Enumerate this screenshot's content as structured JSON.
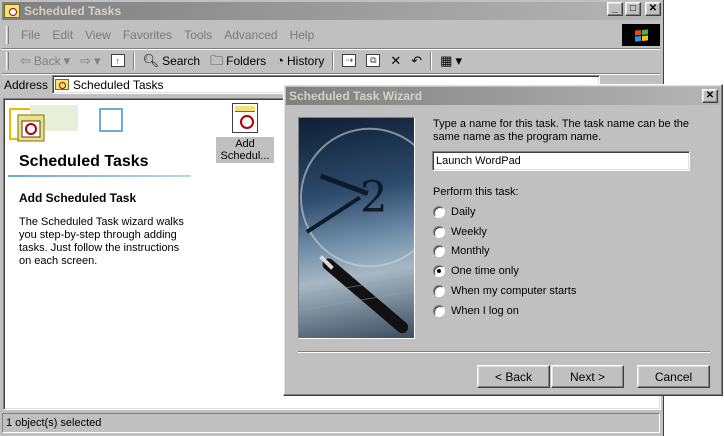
{
  "explorer": {
    "title": "Scheduled Tasks",
    "menu": [
      "File",
      "Edit",
      "View",
      "Favorites",
      "Tools",
      "Advanced",
      "Help"
    ],
    "toolbar": {
      "back": "Back",
      "search": "Search",
      "folders": "Folders",
      "history": "History"
    },
    "address": {
      "label": "Address",
      "value": "Scheduled Tasks"
    },
    "side_panel": {
      "title": "Scheduled Tasks",
      "subtitle": "Add Scheduled Task",
      "description": "The Scheduled Task wizard walks you step-by-step through adding tasks. Just follow the instructions on each screen."
    },
    "items": [
      {
        "label_line1": "Add",
        "label_line2": "Schedul..."
      }
    ],
    "status": "1 object(s) selected"
  },
  "wizard": {
    "title": "Scheduled Task Wizard",
    "prompt": "Type a name for this task.  The task name can be the same name as the program name.",
    "name_value": "Launch WordPad",
    "perform_label": "Perform this task:",
    "options": [
      {
        "label": "Daily",
        "checked": false
      },
      {
        "label": "Weekly",
        "checked": false
      },
      {
        "label": "Monthly",
        "checked": false
      },
      {
        "label": "One time only",
        "checked": true
      },
      {
        "label": "When my computer starts",
        "checked": false
      },
      {
        "label": "When I log on",
        "checked": false
      }
    ],
    "buttons": {
      "back": "< Back",
      "next": "Next >",
      "cancel": "Cancel"
    }
  }
}
